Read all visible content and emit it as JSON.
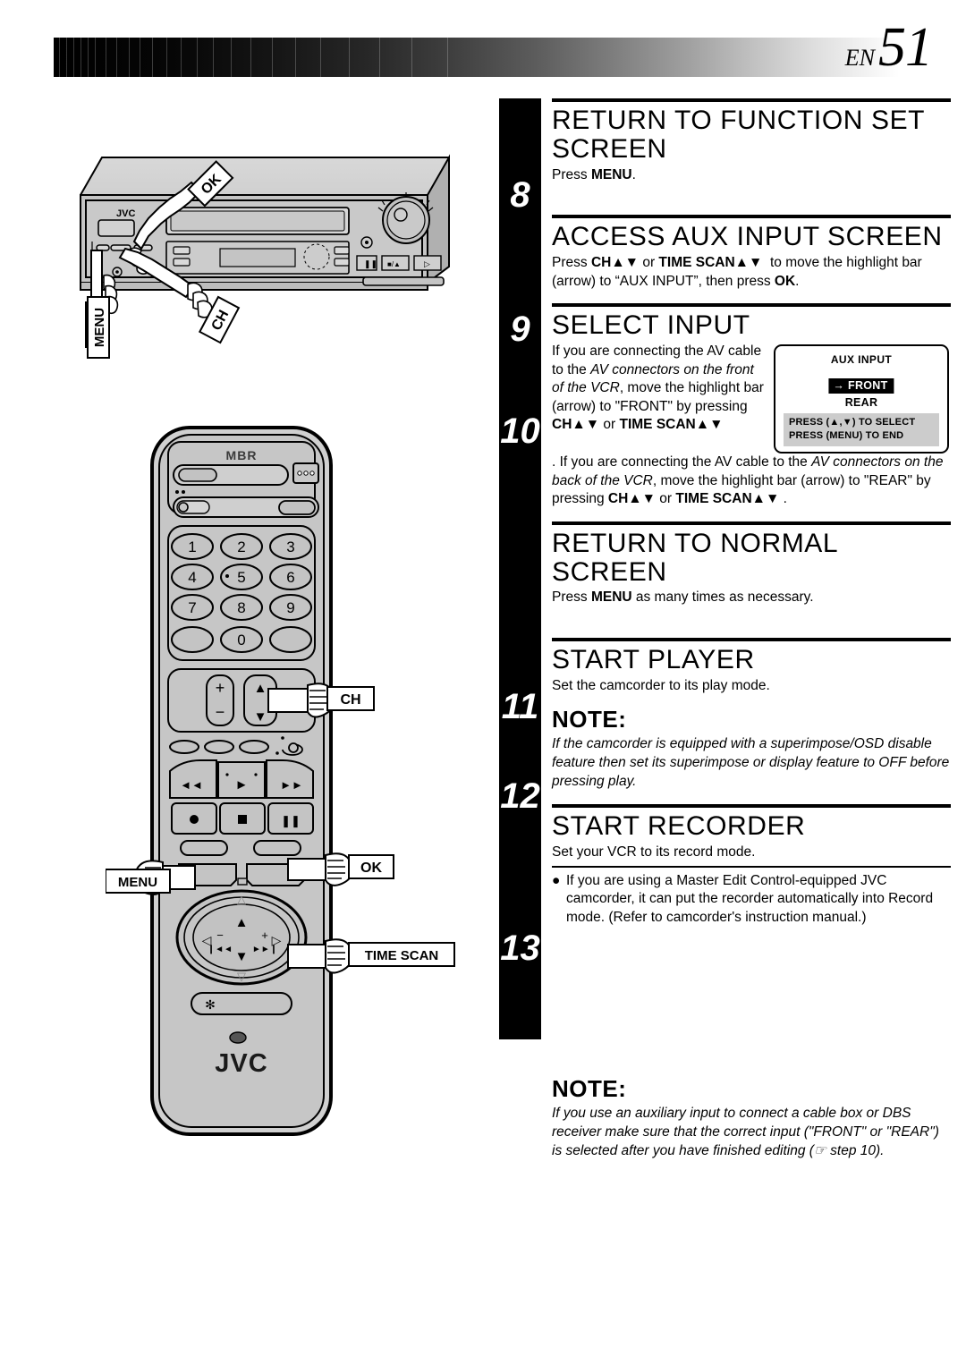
{
  "header": {
    "lang": "EN",
    "page_number": "51"
  },
  "illustrations": {
    "vcr": {
      "brand_label": "JVC",
      "callouts": [
        {
          "name": "ok",
          "label": "OK"
        },
        {
          "name": "ch",
          "label": "CH"
        },
        {
          "name": "menu",
          "label": "MENU"
        }
      ]
    },
    "remote": {
      "top_logo": "MBR",
      "brand_label": "JVC",
      "keypad": [
        "1",
        "2",
        "3",
        "4",
        "5",
        "6",
        "7",
        "8",
        "9",
        "0"
      ],
      "volume_plus": "+",
      "volume_minus": "−",
      "jog_plus": "+",
      "jog_minus": "−",
      "callouts": [
        {
          "name": "ch",
          "label": "CH"
        },
        {
          "name": "menu",
          "label": "MENU"
        },
        {
          "name": "ok",
          "label": "OK"
        },
        {
          "name": "time-scan",
          "label": "TIME SCAN"
        }
      ]
    }
  },
  "steps": [
    {
      "number": "8",
      "title": "RETURN TO FUNCTION SET SCREEN",
      "body_html": "Press <b>MENU</b>."
    },
    {
      "number": "9",
      "title": "ACCESS AUX INPUT SCREEN",
      "body_html": "Press <b>CH▲▼</b> or <b>TIME SCAN▲▼</b>&nbsp; to move the highlight bar (arrow) to “AUX INPUT”, then press <b>OK</b>."
    },
    {
      "number": "10",
      "title": "SELECT INPUT",
      "body_html": "If you are connecting the AV cable to the <i>AV connectors on the front of the VCR</i>, move the highlight bar (arrow) to \"FRONT\" by pressing <b>CH▲▼</b> or <b>TIME SCAN▲▼</b>",
      "body_html_2": ". If you are connecting the AV cable to the <i>AV connectors on the back of the VCR</i>, move the highlight bar (arrow) to \"REAR\" by pressing <b>CH▲▼</b> or <b>TIME SCAN▲▼</b> ."
    },
    {
      "number": "11",
      "title": "RETURN TO NORMAL SCREEN",
      "body_html": "Press <b>MENU</b> as many times as necessary."
    },
    {
      "number": "12",
      "title": "START PLAYER",
      "body_html": "Set the camcorder to its play mode.",
      "note_head": "NOTE:",
      "note_body": "If the camcorder is equipped with a superimpose/OSD disable feature then set its superimpose or display feature to OFF before pressing play."
    },
    {
      "number": "13",
      "title": "START RECORDER",
      "body_html": "Set your VCR to its record mode.",
      "bullet": "If you are using a Master Edit Control-equipped JVC camcorder, it can put the recorder automatically into Record mode. (Refer to camcorder's instruction manual.)"
    }
  ],
  "osd": {
    "title": "AUX INPUT",
    "option_front": "FRONT",
    "option_front_arrow": "→",
    "option_rear": "REAR",
    "footer_line1": "PRESS (▲,▼) TO SELECT",
    "footer_line2": "PRESS (MENU) TO END",
    "highlight_color": "#000000",
    "footer_bg": "#cccccc"
  },
  "bottom_note": {
    "head": "NOTE:",
    "body_html": "If you use an auxiliary input to connect a cable box or DBS receiver make sure that the correct input (\"FRONT\" or \"REAR\") is selected after you have finished editing (☞ step 10)."
  }
}
